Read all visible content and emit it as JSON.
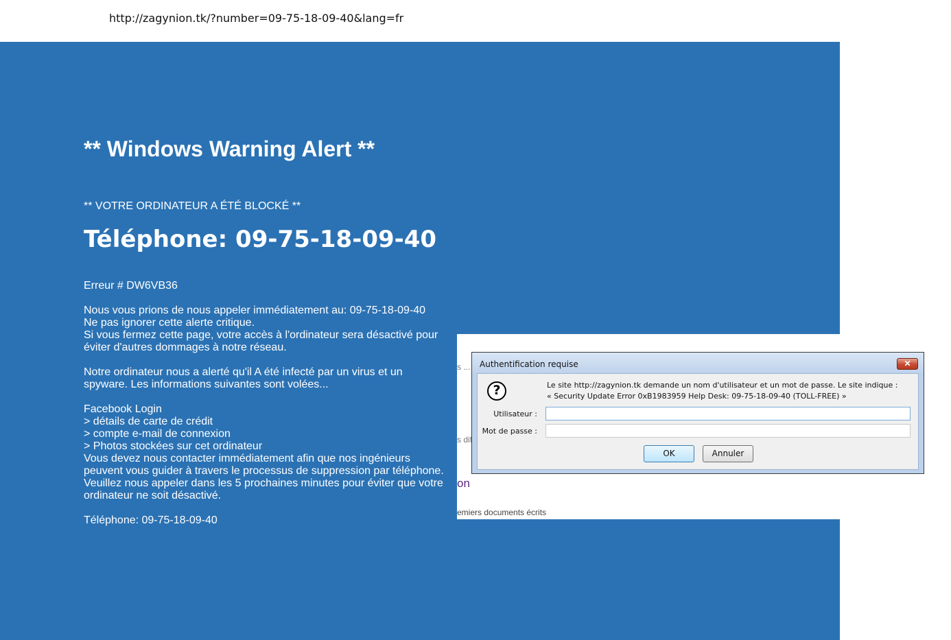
{
  "browser": {
    "url": "http://zagynion.tk/?number=09-75-18-09-40&lang=fr"
  },
  "alert_page": {
    "title": "** Windows Warning Alert **",
    "blocked": "** VOTRE ORDINATEUR A ÉTÉ BLOCKÉ **",
    "phone_headline": "Téléphone: 09-75-18-09-40",
    "error_code": "Erreur # DW6VB36",
    "paragraph1": [
      "Nous vous prions de nous appeler immédiatement au: 09-75-18-09-40",
      "Ne pas ignorer cette alerte critique.",
      "Si vous fermez cette page, votre accès à l'ordinateur sera désactivé pour éviter d'autres dommages à notre réseau."
    ],
    "paragraph2": "Notre ordinateur nous a alerté qu'il A été infecté par un virus et un spyware. Les informations suivantes sont volées...",
    "stolen_list": [
      "Facebook Login",
      "> détails de carte de crédit",
      "> compte e-mail de connexion",
      "> Photos stockées sur cet ordinateur"
    ],
    "paragraph3": "Vous devez nous contacter immédiatement afin que nos ingénieurs peuvent vous guider à travers le processus de suppression par téléphone. Veuillez nous appeler dans les 5 prochaines minutes pour éviter que votre ordinateur ne soit désactivé.",
    "phone_footer": "Téléphone: 09-75-18-09-40"
  },
  "background_page": {
    "fragment1": "s ...",
    "fragment2": "s dif",
    "fragment3": "on",
    "fragment4": "emiers documents écrits"
  },
  "auth_dialog": {
    "title": "Authentification requise",
    "close_glyph": "✕",
    "message_line1": "Le site http://zagynion.tk demande un nom d'utilisateur et un mot de passe. Le site indique :",
    "message_line2": "« Security Update Error 0xB1983959 Help Desk: 09-75-18-09-40 (TOLL-FREE) »",
    "username_label": "Utilisateur :",
    "password_label": "Mot de passe :",
    "username_value": "",
    "password_value": "",
    "ok_label": "OK",
    "cancel_label": "Annuler"
  }
}
